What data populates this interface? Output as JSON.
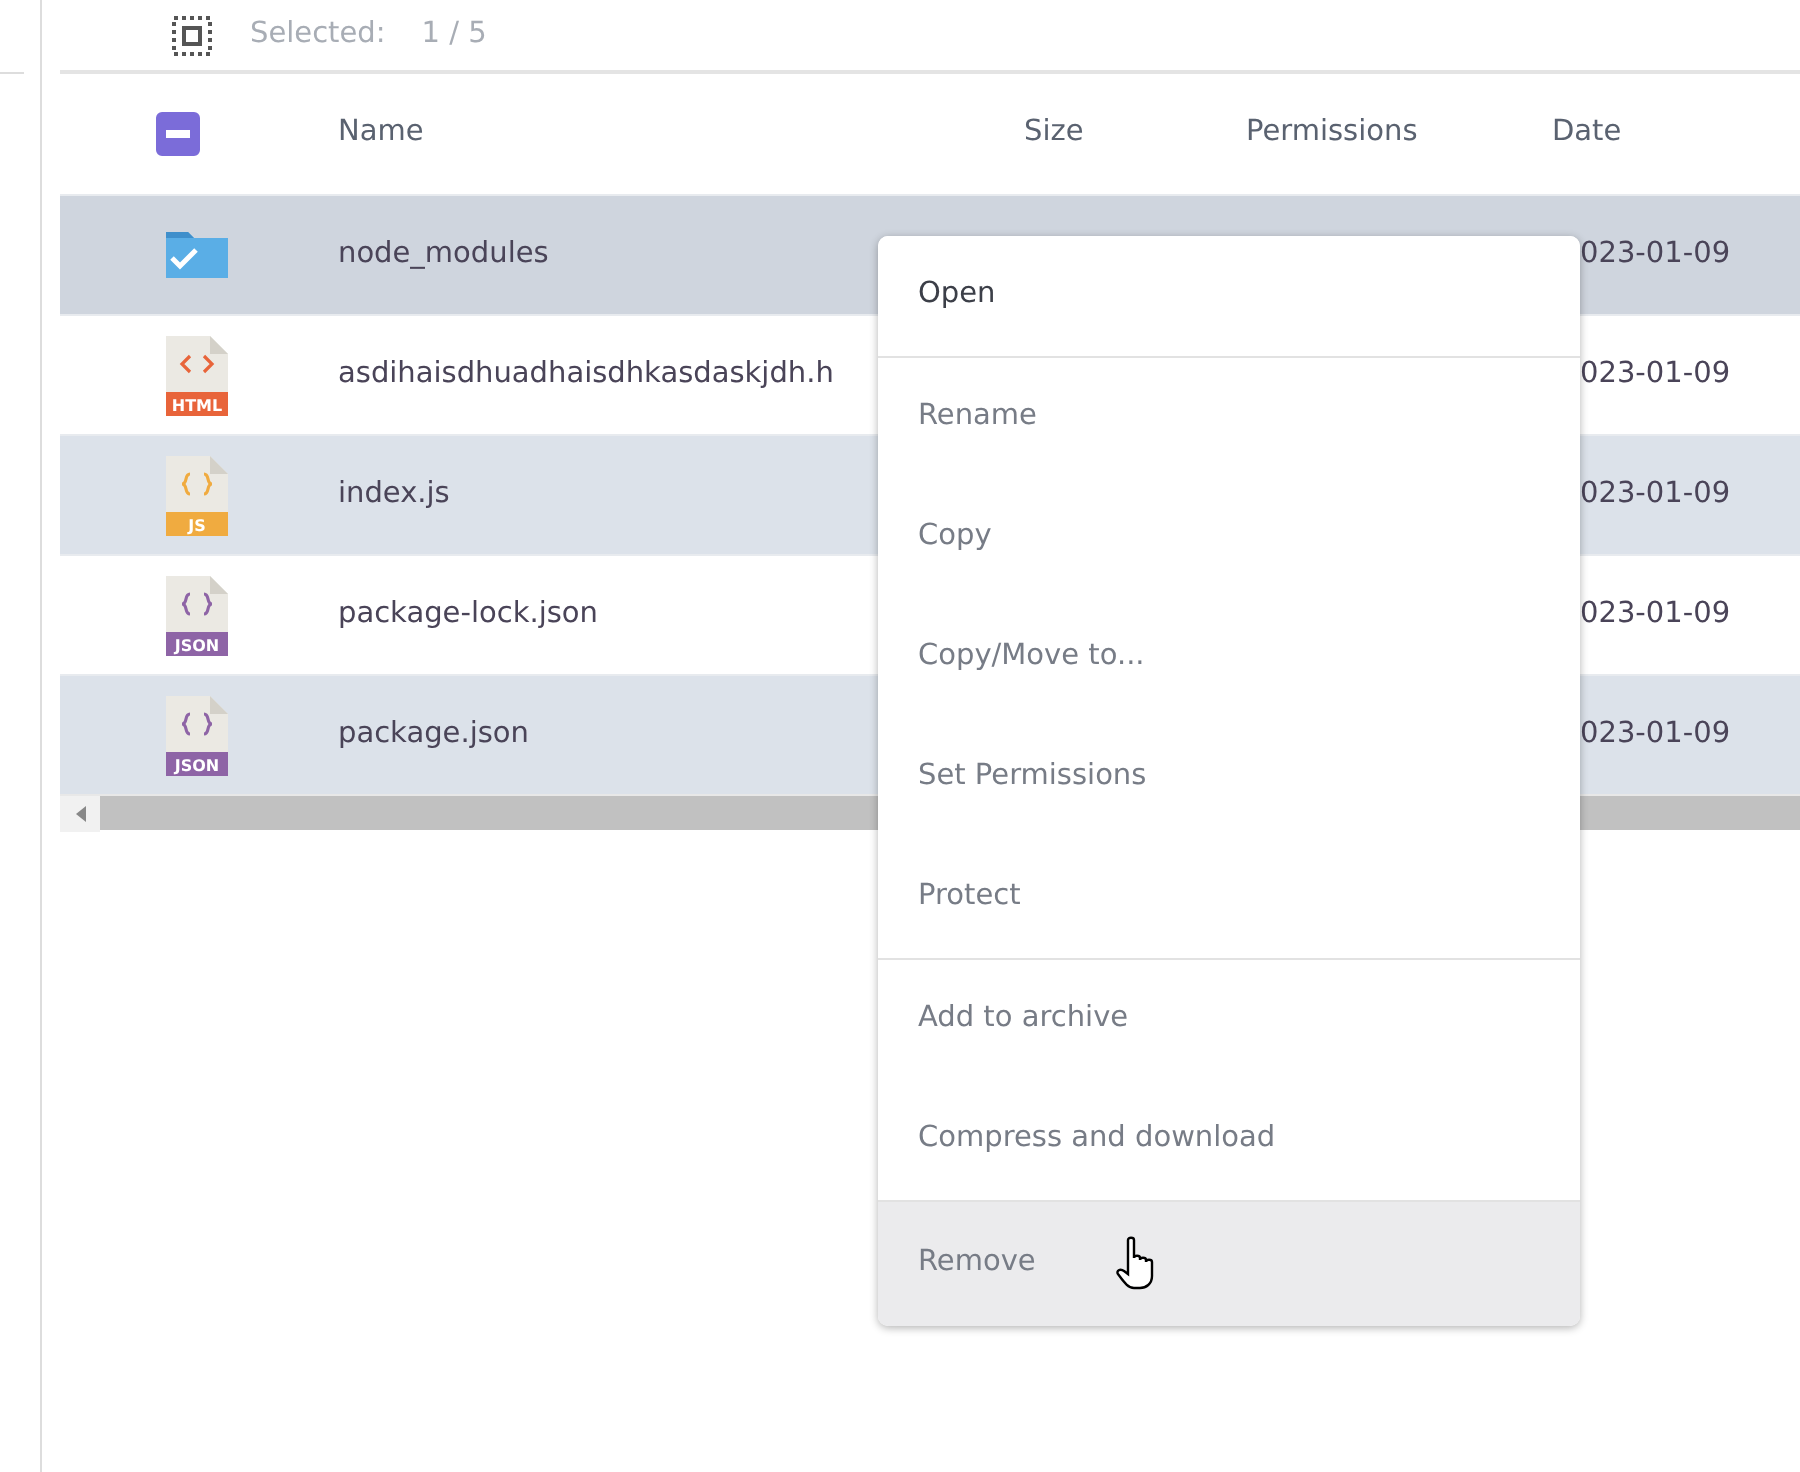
{
  "selection": {
    "label": "Selected:",
    "count": "1 / 5"
  },
  "table": {
    "select_all": {
      "indeterminate": true
    },
    "columns": [
      "Name",
      "Size",
      "Permissions",
      "Date"
    ],
    "rows": [
      {
        "kind": "folder",
        "badge": "",
        "name": "node_modules",
        "date": "023-01-09",
        "selected": true,
        "striped": false
      },
      {
        "kind": "html",
        "badge": "HTML",
        "name": "asdihaisdhuadhaisdhkasdaskjdh.h",
        "date": "023-01-09",
        "selected": false,
        "striped": false
      },
      {
        "kind": "js",
        "badge": "JS",
        "name": "index.js",
        "date": "023-01-09",
        "selected": false,
        "striped": true
      },
      {
        "kind": "json",
        "badge": "JSON",
        "name": "package-lock.json",
        "date": "023-01-09",
        "selected": false,
        "striped": false
      },
      {
        "kind": "json",
        "badge": "JSON",
        "name": "package.json",
        "date": "023-01-09",
        "selected": false,
        "striped": true
      }
    ]
  },
  "context_menu": {
    "groups": [
      [
        {
          "label": "Open",
          "primary": true,
          "hovered": false
        }
      ],
      [
        {
          "label": "Rename",
          "primary": false,
          "hovered": false
        },
        {
          "label": "Copy",
          "primary": false,
          "hovered": false
        },
        {
          "label": "Copy/Move to...",
          "primary": false,
          "hovered": false
        },
        {
          "label": "Set Permissions",
          "primary": false,
          "hovered": false
        },
        {
          "label": "Protect",
          "primary": false,
          "hovered": false
        }
      ],
      [
        {
          "label": "Add to archive",
          "primary": false,
          "hovered": false
        },
        {
          "label": "Compress and download",
          "primary": false,
          "hovered": false
        }
      ],
      [
        {
          "label": "Remove",
          "primary": false,
          "hovered": true
        }
      ]
    ]
  }
}
